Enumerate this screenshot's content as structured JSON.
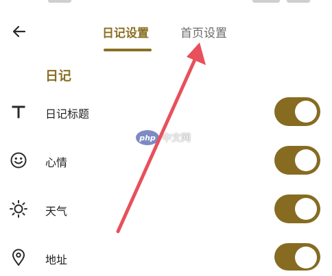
{
  "tabs": [
    {
      "label": "日记设置",
      "active": true
    },
    {
      "label": "首页设置",
      "active": false
    }
  ],
  "section": {
    "title": "日记"
  },
  "settings": [
    {
      "label": "日记标题",
      "icon": "text-icon",
      "enabled": true
    },
    {
      "label": "心情",
      "icon": "smiley-icon",
      "enabled": true
    },
    {
      "label": "天气",
      "icon": "sun-icon",
      "enabled": true
    },
    {
      "label": "地址",
      "icon": "location-pin-icon",
      "enabled": true
    }
  ],
  "watermark": {
    "badge": "php",
    "text": "中文网"
  },
  "colors": {
    "accent": "#8a6f24",
    "toggle_on": "#866b21",
    "arrow": "#e8505b"
  }
}
